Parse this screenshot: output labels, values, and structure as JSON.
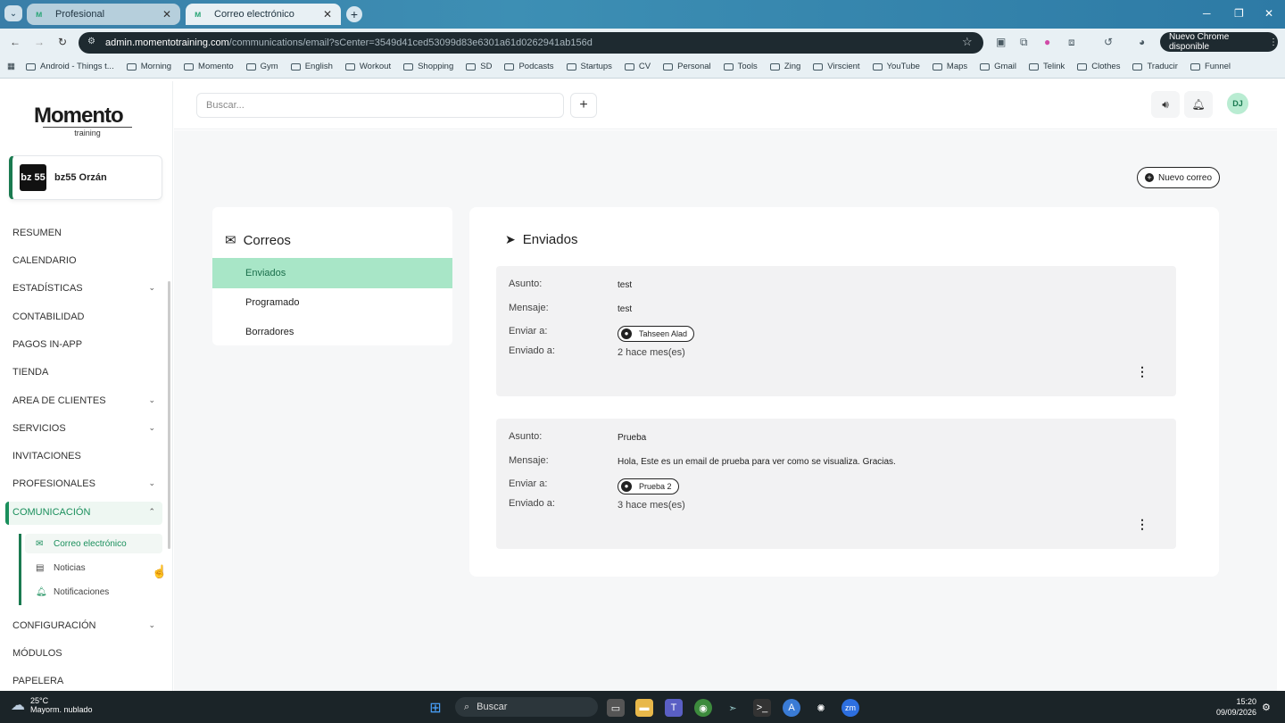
{
  "browser": {
    "tabs": [
      {
        "label": "Profesional"
      },
      {
        "label": "Correo electrónico"
      }
    ],
    "url_domain": "admin.momentotraining.com",
    "url_path": "/communications/email?sCenter=3549d41ced53099d83e6301a61d0262941ab156d",
    "update_badge": "Nuevo Chrome disponible",
    "bookmarks": [
      "Android - Things t...",
      "Morning",
      "Momento",
      "Gym",
      "English",
      "Workout",
      "Shopping",
      "SD",
      "Podcasts",
      "Startups",
      "CV",
      "Personal",
      "Tools",
      "Zing",
      "Virscient",
      "YouTube",
      "Maps",
      "Gmail",
      "Telink",
      "Clothes",
      "Traducir",
      "Funnel"
    ]
  },
  "sidebar": {
    "logo_text": "Momento",
    "logo_sub": "training",
    "center_avatar": "bz 55",
    "center_name": "bz55 Orzán",
    "items": [
      {
        "label": "RESUMEN"
      },
      {
        "label": "CALENDARIO"
      },
      {
        "label": "ESTADÍSTICAS",
        "chev": "⌄"
      },
      {
        "label": "CONTABILIDAD"
      },
      {
        "label": "PAGOS IN-APP"
      },
      {
        "label": "TIENDA"
      },
      {
        "label": "AREA DE CLIENTES",
        "chev": "⌄"
      },
      {
        "label": "SERVICIOS",
        "chev": "⌄"
      },
      {
        "label": "INVITACIONES"
      },
      {
        "label": "PROFESIONALES",
        "chev": "⌄"
      },
      {
        "label": "COMUNICACIÓN",
        "chev": "⌃"
      },
      {
        "label": "CONFIGURACIÓN",
        "chev": "⌄"
      },
      {
        "label": "MÓDULOS"
      },
      {
        "label": "PAPELERA"
      }
    ],
    "subitems": [
      {
        "label": "Correo electrónico"
      },
      {
        "label": "Noticias"
      },
      {
        "label": "Notificaciones"
      }
    ]
  },
  "topbar": {
    "search_placeholder": "Buscar...",
    "user_initials": "DJ"
  },
  "main": {
    "new_mail_label": "Nuevo correo",
    "folders_title": "Correos",
    "folders": [
      {
        "label": "Enviados"
      },
      {
        "label": "Programado"
      },
      {
        "label": "Borradores"
      }
    ],
    "sent_title": "Enviados",
    "labels": {
      "subject": "Asunto:",
      "message": "Mensaje:",
      "send_to": "Enviar a:",
      "sent_at": "Enviado a:"
    },
    "emails": [
      {
        "subject": "test",
        "message": "test",
        "recipient": "Tahseen Alad",
        "sent_ago": "2 hace mes(es)"
      },
      {
        "subject": "Prueba",
        "message": "Hola,  Este es un email de prueba para ver como se visualiza. Gracias.",
        "recipient": "Prueba 2",
        "sent_ago": "3 hace mes(es)"
      }
    ]
  },
  "taskbar": {
    "temp": "25°C",
    "weather": "Mayorm. nublado",
    "search": "Buscar",
    "time": "15:20",
    "date": "09/09/2026"
  },
  "colors": {
    "accent": "#1a8f5c",
    "selected_folder": "#a8e6c7"
  }
}
